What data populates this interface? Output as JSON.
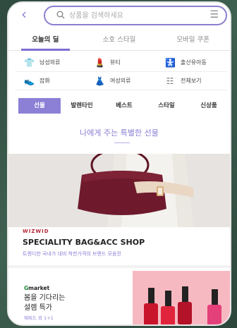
{
  "search": {
    "placeholder": "상품을 검색하세요",
    "back_glyph": "‹",
    "menu_glyph": "☰"
  },
  "tabs": [
    {
      "label": "오늘의 딜"
    },
    {
      "label": "소호 스타일"
    },
    {
      "label": "모바일 쿠폰"
    }
  ],
  "categories": [
    {
      "icon": "shirt-icon",
      "glyph": "👕",
      "label": "남성의류"
    },
    {
      "icon": "lipstick-icon",
      "glyph": "💄",
      "label": "뷰티"
    },
    {
      "icon": "stroller-icon",
      "glyph": "🚼",
      "label": "출산유아동"
    },
    {
      "icon": "shoe-icon",
      "glyph": "👟",
      "label": "잡화"
    },
    {
      "icon": "dress-icon",
      "glyph": "👗",
      "label": "여성의류"
    },
    {
      "icon": "list-icon",
      "glyph": "☷",
      "label": "전체보기"
    }
  ],
  "theme_tabs": [
    {
      "label": "선물"
    },
    {
      "label": "발렌타인"
    },
    {
      "label": "베스트"
    },
    {
      "label": "스타일"
    },
    {
      "label": "신상품"
    }
  ],
  "section_title": "나에게 주는 특별한 선물",
  "banner": {
    "brand": "WIZWID",
    "title": "SPECIALITY BAG&ACC SHOP",
    "subtitle": "트렌디한 국내가 대비 착한가격의 브랜드 모음전"
  },
  "promo": {
    "brand_g": "G",
    "brand_rest": "market",
    "title": "봄을 기다리는\n설렘 특가",
    "subtitle": "에뛰드 외 1+1"
  },
  "colors": {
    "accent": "#8b80d6",
    "bag": "#6e1a2c",
    "polish_bg": "#f7b9c1"
  }
}
